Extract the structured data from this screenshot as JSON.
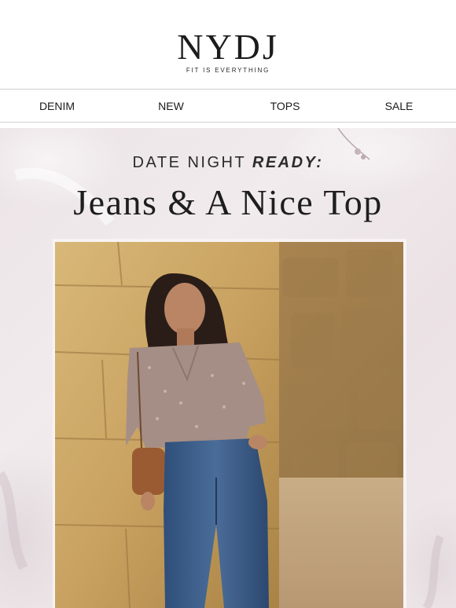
{
  "brand": {
    "logo_text": "NYDJ",
    "tagline": "FIT IS EVERYTHING"
  },
  "nav": {
    "items": [
      {
        "label": "DENIM"
      },
      {
        "label": "NEW"
      },
      {
        "label": "TOPS"
      },
      {
        "label": "SALE"
      }
    ]
  },
  "hero": {
    "kicker_plain": "DATE NIGHT ",
    "kicker_emphasis": "READY:",
    "headline": "Jeans & A Nice Top",
    "background_color": "#ede5e8"
  },
  "photo": {
    "subject": "model in blouse and jeans against stone wall"
  }
}
